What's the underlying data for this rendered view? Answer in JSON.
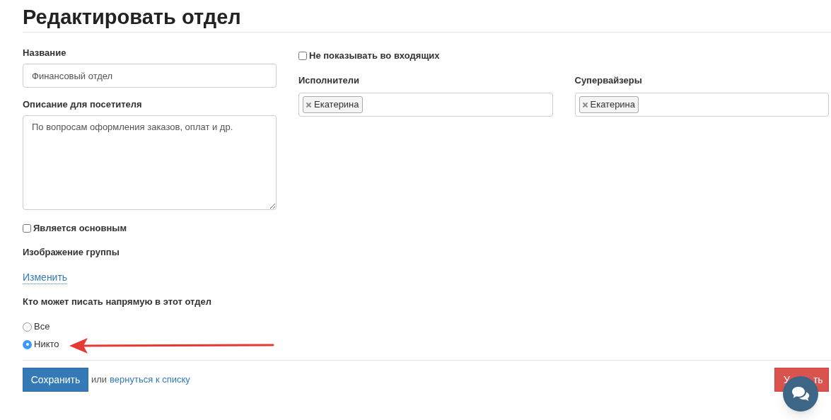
{
  "title": "Редактировать отдел",
  "name_field": {
    "label": "Название",
    "value": "Финансовый отдел"
  },
  "description_field": {
    "label": "Описание для посетителя",
    "value": "По вопросам оформления заказов, оплат и др."
  },
  "is_main": {
    "label": "Является основным",
    "checked": false
  },
  "group_image": {
    "label": "Изображение группы",
    "link": "Изменить"
  },
  "who_can_write": {
    "label": "Кто может писать напрямую в этот отдел",
    "options": [
      {
        "label": "Все",
        "selected": false
      },
      {
        "label": "Никто",
        "selected": true
      }
    ]
  },
  "hide_in_inbox": {
    "label": "Не показывать во входящих",
    "checked": false
  },
  "tag_fields": [
    {
      "label": "Исполнители",
      "tags": [
        "Екатерина"
      ]
    },
    {
      "label": "Супервайзеры",
      "tags": [
        "Екатерина"
      ]
    }
  ],
  "footer": {
    "save": "Сохранить",
    "or": "или",
    "back_link": "вернуться к списку",
    "delete_label_start": "У",
    "delete_label_end": "ть"
  }
}
